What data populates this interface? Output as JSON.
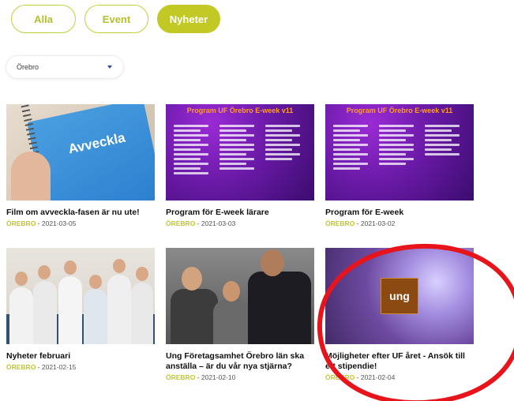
{
  "filters": {
    "tabs": [
      {
        "label": "Alla",
        "active": false
      },
      {
        "label": "Event",
        "active": false
      },
      {
        "label": "Nyheter",
        "active": true
      }
    ]
  },
  "location_select": {
    "value": "Örebro"
  },
  "articles": [
    {
      "title": "Film om avveckla-fasen är nu ute!",
      "city": "ÖREBRO",
      "date": " - 2021-03-05",
      "thumb_text": "Avveckla"
    },
    {
      "title": "Program för E-week lärare",
      "city": "ÖREBRO",
      "date": " - 2021-03-03",
      "thumb_text": "Program UF Örebro E-week v11"
    },
    {
      "title": "Program för E-week",
      "city": "ÖREBRO",
      "date": " - 2021-03-02",
      "thumb_text": "Program UF Örebro E-week v11"
    },
    {
      "title": "Nyheter februari",
      "city": "ÖREBRO",
      "date": " - 2021-02-15"
    },
    {
      "title": "Ung Företagsamhet Örebro län ska anställa – är du vår nya stjärna?",
      "city": "ÖREBRO",
      "date": " - 2021-02-10"
    },
    {
      "title": "Möjligheter efter UF året - Ansök till ett stipendie!",
      "city": "ÖREBRO",
      "date": " - 2021-02-04",
      "thumb_text": "ung"
    }
  ],
  "colors": {
    "accent": "#c2c824",
    "annotation": "#e8141b"
  }
}
